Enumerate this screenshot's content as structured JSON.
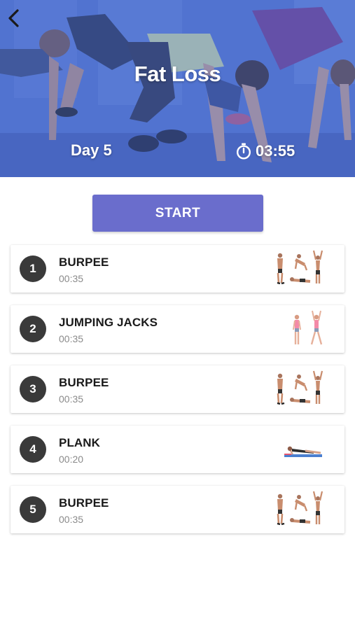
{
  "header": {
    "title": "Fat Loss",
    "day": "Day 5",
    "duration": "03:55",
    "icons": {
      "back": "chevron-left-icon",
      "timer": "stopwatch-icon"
    }
  },
  "start": {
    "label": "START",
    "color": "#6a6dcc"
  },
  "exercises": [
    {
      "number": "1",
      "name": "BURPEE",
      "time": "00:35",
      "illustration": "burpee-illustration"
    },
    {
      "number": "2",
      "name": "JUMPING JACKS",
      "time": "00:35",
      "illustration": "jumping-jacks-illustration"
    },
    {
      "number": "3",
      "name": "BURPEE",
      "time": "00:35",
      "illustration": "burpee-illustration"
    },
    {
      "number": "4",
      "name": "PLANK",
      "time": "00:20",
      "illustration": "plank-illustration"
    },
    {
      "number": "5",
      "name": "BURPEE",
      "time": "00:35",
      "illustration": "burpee-illustration"
    }
  ]
}
